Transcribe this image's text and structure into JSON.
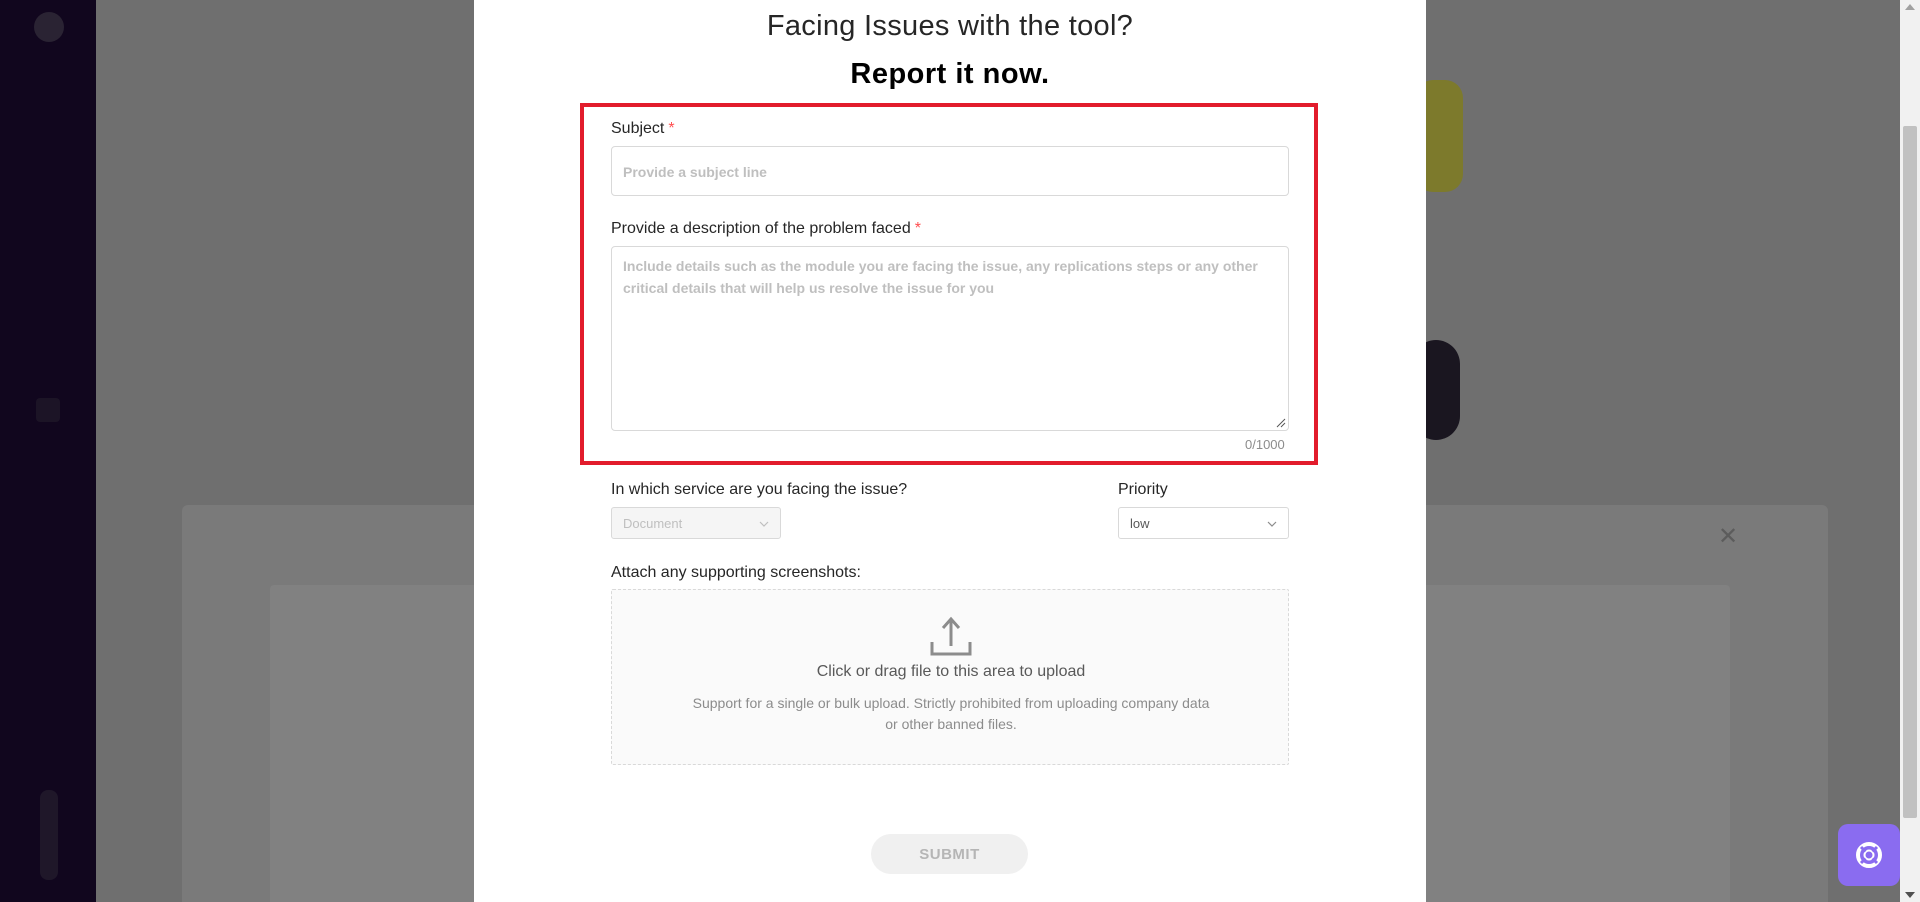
{
  "modal": {
    "title": "Facing Issues with the tool?",
    "subtitle": "Report it now."
  },
  "form": {
    "subject": {
      "label": "Subject",
      "required_mark": "*",
      "placeholder": "Provide a subject line",
      "value": ""
    },
    "description": {
      "label": "Provide a description of the problem faced",
      "required_mark": "*",
      "placeholder": "Include details such as the module you are facing the issue, any replications steps or any other critical details that will help us resolve the issue for you",
      "value": "",
      "counter": "0/1000"
    },
    "service": {
      "label": "In which service are you facing the issue?",
      "selected": "Document",
      "disabled": true
    },
    "priority": {
      "label": "Priority",
      "selected": "low"
    },
    "attachments": {
      "label": "Attach any supporting screenshots:",
      "drop_text": "Click or drag file to this area to upload",
      "hint": "Support for a single or bulk upload. Strictly prohibited from uploading company data or other banned files."
    },
    "submit_label": "SUBMIT"
  },
  "colors": {
    "highlight": "#e21c2c",
    "help_button": "#8a6cf0",
    "required": "#ff4d4f"
  },
  "icons": {
    "upload": "upload-icon",
    "chevron": "chevron-down-icon",
    "help": "lifebuoy-icon"
  }
}
